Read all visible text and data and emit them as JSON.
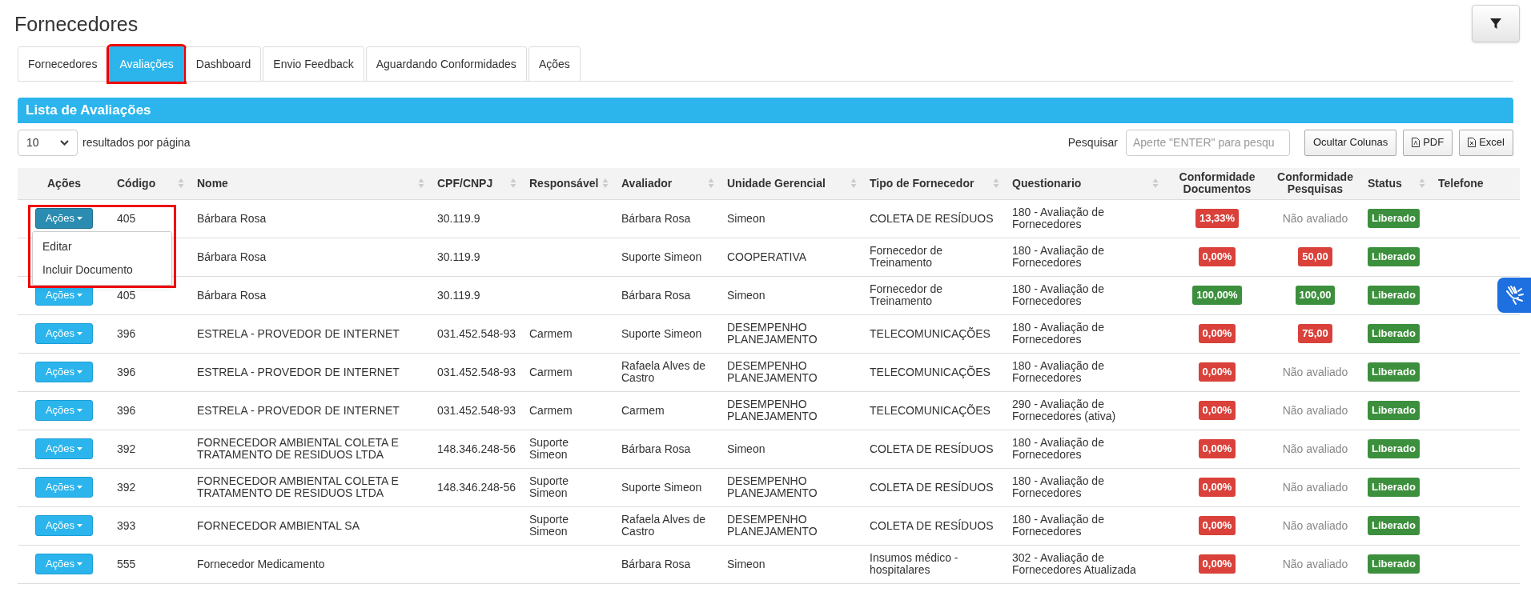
{
  "page_title": "Fornecedores",
  "tabs": [
    {
      "label": "Fornecedores",
      "selected": false,
      "highlighted": false
    },
    {
      "label": "Avaliações",
      "selected": true,
      "highlighted": true
    },
    {
      "label": "Dashboard",
      "selected": false,
      "highlighted": false
    },
    {
      "label": "Envio Feedback",
      "selected": false,
      "highlighted": false
    },
    {
      "label": "Aguardando Conformidades",
      "selected": false,
      "highlighted": false
    },
    {
      "label": "Ações",
      "selected": false,
      "highlighted": false
    }
  ],
  "panel_title": "Lista de Avaliações",
  "page_size": {
    "value": "10",
    "label": "resultados por página"
  },
  "search": {
    "label": "Pesquisar",
    "placeholder": "Aperte \"ENTER\" para pesqu"
  },
  "buttons": [
    {
      "kind": "plain",
      "label": "Ocultar Colunas"
    },
    {
      "kind": "pdf",
      "label": "PDF"
    },
    {
      "kind": "excel",
      "label": "Excel"
    }
  ],
  "columns": [
    {
      "label": "Ações",
      "sortable": false
    },
    {
      "label": "Código",
      "sortable": true
    },
    {
      "label": "Nome",
      "sortable": true
    },
    {
      "label": "CPF/CNPJ",
      "sortable": true
    },
    {
      "label": "Responsável",
      "sortable": true
    },
    {
      "label": "Avaliador",
      "sortable": true
    },
    {
      "label": "Unidade Gerencial",
      "sortable": true
    },
    {
      "label": "Tipo de Fornecedor",
      "sortable": true
    },
    {
      "label": "Questionario",
      "sortable": true
    },
    {
      "label": "Conformidade Documentos",
      "sortable": false
    },
    {
      "label": "Conformidade Pesquisas",
      "sortable": false
    },
    {
      "label": "Status",
      "sortable": true
    },
    {
      "label": "Telefone",
      "sortable": false
    }
  ],
  "dropdown": {
    "highlighted": true,
    "items": [
      "Editar",
      "Incluir Documento"
    ]
  },
  "rows": [
    {
      "acoes": {
        "label": "Ações",
        "active": true
      },
      "codigo": "405",
      "nome": "Bárbara Rosa",
      "cpf": "30.119.9",
      "avaliador": "Bárbara Rosa",
      "unidade": "Simeon",
      "tipo": "COLETA DE RESÍDUOS",
      "questionario": "180 - Avaliação de Fornecedores",
      "docs": {
        "kind": "badge",
        "text": "13,33%",
        "ok": false
      },
      "pesquisas": {
        "kind": "text",
        "text": "Não avaliado"
      },
      "status": "Liberado"
    },
    {
      "nome": "Bárbara Rosa",
      "cpf": "30.119.9",
      "avaliador": "Suporte Simeon",
      "unidade": "COOPERATIVA",
      "tipo": "Fornecedor de Treinamento",
      "questionario": "180 - Avaliação de Fornecedores",
      "docs": {
        "kind": "badge",
        "text": "0,00%",
        "ok": false
      },
      "pesquisas": {
        "kind": "badge",
        "text": "50,00",
        "ok": false
      },
      "status": "Liberado"
    },
    {
      "acoes": {
        "label": "Ações",
        "active": false
      },
      "codigo": "405",
      "nome": "Bárbara Rosa",
      "cpf": "30.119.9",
      "avaliador": "Bárbara Rosa",
      "unidade": "Simeon",
      "tipo": "Fornecedor de Treinamento",
      "questionario": "180 - Avaliação de Fornecedores",
      "docs": {
        "kind": "badge",
        "text": "100,00%",
        "ok": true
      },
      "pesquisas": {
        "kind": "badge",
        "text": "100,00",
        "ok": true
      },
      "status": "Liberado"
    },
    {
      "acoes": {
        "label": "Ações",
        "active": false
      },
      "codigo": "396",
      "nome": "ESTRELA - PROVEDOR DE INTERNET",
      "cpf": "031.452.548-93",
      "responsavel": "Carmem",
      "avaliador": "Suporte Simeon",
      "unidade": "DESEMPENHO PLANEJAMENTO",
      "tipo": "TELECOMUNICAÇÕES",
      "questionario": "180 - Avaliação de Fornecedores",
      "docs": {
        "kind": "badge",
        "text": "0,00%",
        "ok": false
      },
      "pesquisas": {
        "kind": "badge",
        "text": "75,00",
        "ok": false
      },
      "status": "Liberado"
    },
    {
      "acoes": {
        "label": "Ações",
        "active": false
      },
      "codigo": "396",
      "nome": "ESTRELA - PROVEDOR DE INTERNET",
      "cpf": "031.452.548-93",
      "responsavel": "Carmem",
      "avaliador": "Rafaela Alves de Castro",
      "unidade": "DESEMPENHO PLANEJAMENTO",
      "tipo": "TELECOMUNICAÇÕES",
      "questionario": "180 - Avaliação de Fornecedores",
      "docs": {
        "kind": "badge",
        "text": "0,00%",
        "ok": false
      },
      "pesquisas": {
        "kind": "text",
        "text": "Não avaliado"
      },
      "status": "Liberado"
    },
    {
      "acoes": {
        "label": "Ações",
        "active": false
      },
      "codigo": "396",
      "nome": "ESTRELA - PROVEDOR DE INTERNET",
      "cpf": "031.452.548-93",
      "responsavel": "Carmem",
      "avaliador": "Carmem",
      "unidade": "DESEMPENHO PLANEJAMENTO",
      "tipo": "TELECOMUNICAÇÕES",
      "questionario": "290 - Avaliação de Fornecedores (ativa)",
      "docs": {
        "kind": "badge",
        "text": "0,00%",
        "ok": false
      },
      "pesquisas": {
        "kind": "text",
        "text": "Não avaliado"
      },
      "status": "Liberado"
    },
    {
      "acoes": {
        "label": "Ações",
        "active": false
      },
      "codigo": "392",
      "nome": "FORNECEDOR AMBIENTAL COLETA E TRATAMENTO DE RESIDUOS LTDA",
      "cpf": "148.346.248-56",
      "responsavel": "Suporte Simeon",
      "avaliador": "Bárbara Rosa",
      "unidade": "Simeon",
      "tipo": "COLETA DE RESÍDUOS",
      "questionario": "180 - Avaliação de Fornecedores",
      "docs": {
        "kind": "badge",
        "text": "0,00%",
        "ok": false
      },
      "pesquisas": {
        "kind": "text",
        "text": "Não avaliado"
      },
      "status": "Liberado"
    },
    {
      "acoes": {
        "label": "Ações",
        "active": false
      },
      "codigo": "392",
      "nome": "FORNECEDOR AMBIENTAL COLETA E TRATAMENTO DE RESIDUOS LTDA",
      "cpf": "148.346.248-56",
      "responsavel": "Suporte Simeon",
      "avaliador": "Suporte Simeon",
      "unidade": "DESEMPENHO PLANEJAMENTO",
      "tipo": "COLETA DE RESÍDUOS",
      "questionario": "180 - Avaliação de Fornecedores",
      "docs": {
        "kind": "badge",
        "text": "0,00%",
        "ok": false
      },
      "pesquisas": {
        "kind": "text",
        "text": "Não avaliado"
      },
      "status": "Liberado"
    },
    {
      "acoes": {
        "label": "Ações",
        "active": false
      },
      "codigo": "393",
      "nome": "FORNECEDOR AMBIENTAL SA",
      "responsavel": "Suporte Simeon",
      "avaliador": "Rafaela Alves de Castro",
      "unidade": "DESEMPENHO PLANEJAMENTO",
      "tipo": "COLETA DE RESÍDUOS",
      "questionario": "180 - Avaliação de Fornecedores",
      "docs": {
        "kind": "badge",
        "text": "0,00%",
        "ok": false
      },
      "pesquisas": {
        "kind": "text",
        "text": "Não avaliado"
      },
      "status": "Liberado"
    },
    {
      "acoes": {
        "label": "Ações",
        "active": false
      },
      "codigo": "555",
      "nome": "Fornecedor Medicamento",
      "avaliador": "Bárbara Rosa",
      "unidade": "Simeon",
      "tipo": "Insumos médico - hospitalares",
      "questionario": "302 - Avaliação de Fornecedores Atualizada",
      "docs": {
        "kind": "badge",
        "text": "0,00%",
        "ok": false
      },
      "pesquisas": {
        "kind": "text",
        "text": "Não avaliado"
      },
      "status": "Liberado"
    }
  ]
}
